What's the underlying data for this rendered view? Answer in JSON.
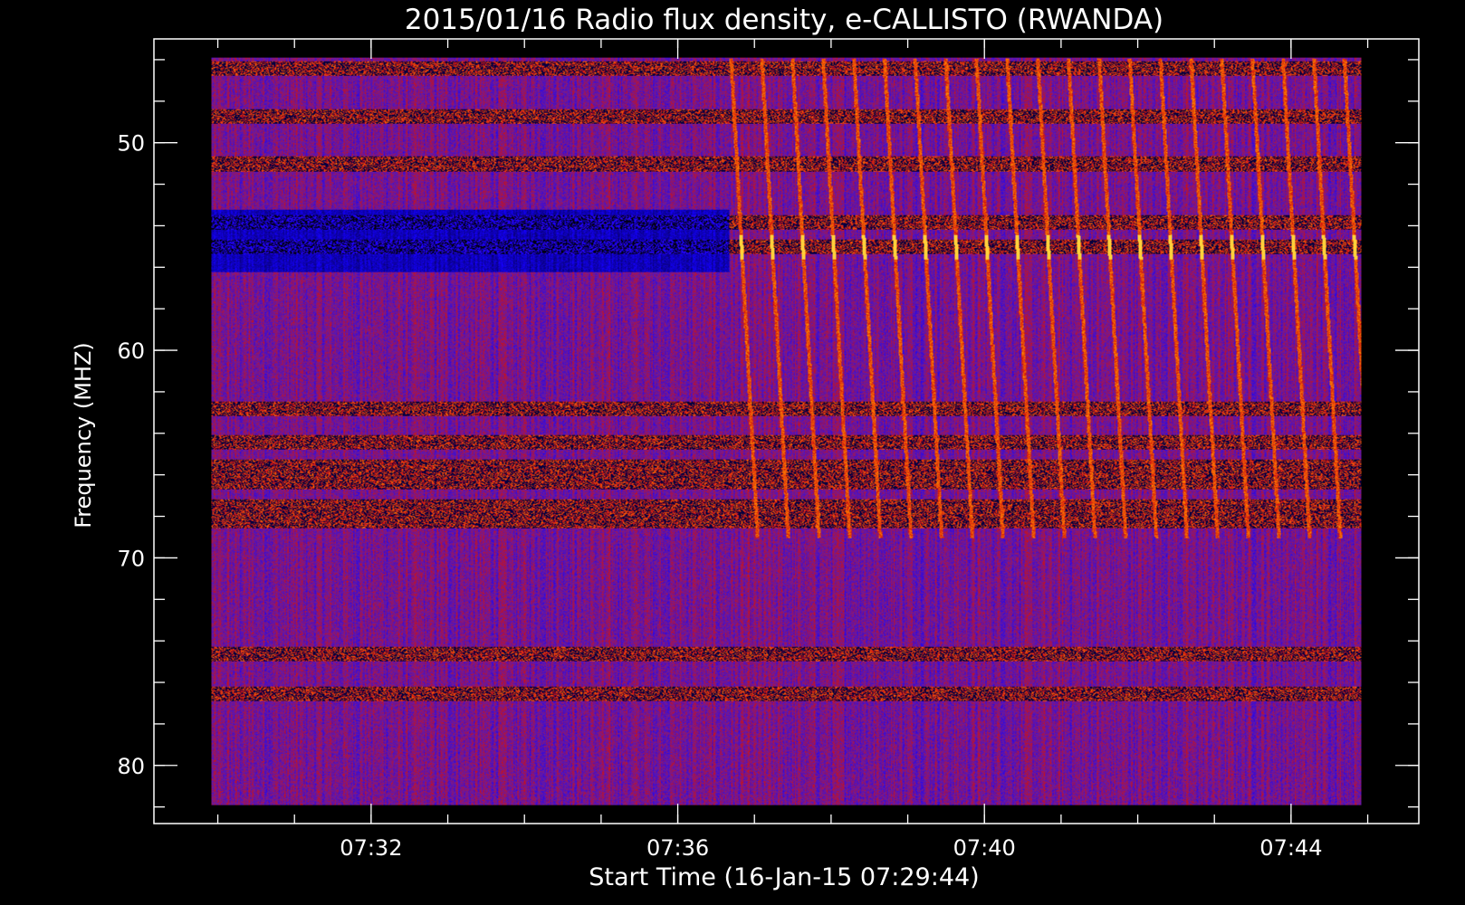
{
  "chart_data": {
    "type": "heatmap",
    "title": "2015/01/16  Radio flux density, e-CALLISTO (RWANDA)",
    "xlabel": "Start Time (16-Jan-15 07:29:44)",
    "ylabel": "Frequency (MHZ)",
    "x_axis": {
      "unit": "time of day (UT)",
      "range": [
        "07:29:10",
        "07:45:40"
      ],
      "data_extent": [
        "07:29:55",
        "07:44:55"
      ],
      "ticks": [
        {
          "value": "07:32",
          "label": "07:32"
        },
        {
          "value": "07:36",
          "label": "07:36"
        },
        {
          "value": "07:40",
          "label": "07:40"
        },
        {
          "value": "07:44",
          "label": "07:44"
        }
      ],
      "minor_tick_interval_seconds": 60
    },
    "y_axis": {
      "unit": "MHz",
      "range": [
        45.0,
        82.8
      ],
      "inverted": true,
      "data_extent": [
        45.9,
        81.9
      ],
      "ticks": [
        {
          "value": 50,
          "label": "50"
        },
        {
          "value": 60,
          "label": "60"
        },
        {
          "value": 70,
          "label": "70"
        },
        {
          "value": 80,
          "label": "80"
        }
      ],
      "minor_tick_interval": 2
    },
    "grid": false,
    "colormap": [
      "#000000",
      "#1400ff",
      "#6a1aa0",
      "#d01010",
      "#ff8a00",
      "#ffff60"
    ],
    "background_color": "#000000",
    "axis_color": "#ffffff",
    "features": {
      "interference_band_frequencies_mhz": [
        46.4,
        48.7,
        51.0,
        53.8,
        55.0,
        62.8,
        64.4,
        65.6,
        66.3,
        67.5,
        68.2,
        74.6,
        76.5
      ],
      "burst_onset_time": "07:36:40",
      "burst_frequency_range_mhz": [
        45.9,
        69.0
      ],
      "burst_drift_period_seconds": 24,
      "bright_band_frequency_mhz": 55.0
    }
  }
}
